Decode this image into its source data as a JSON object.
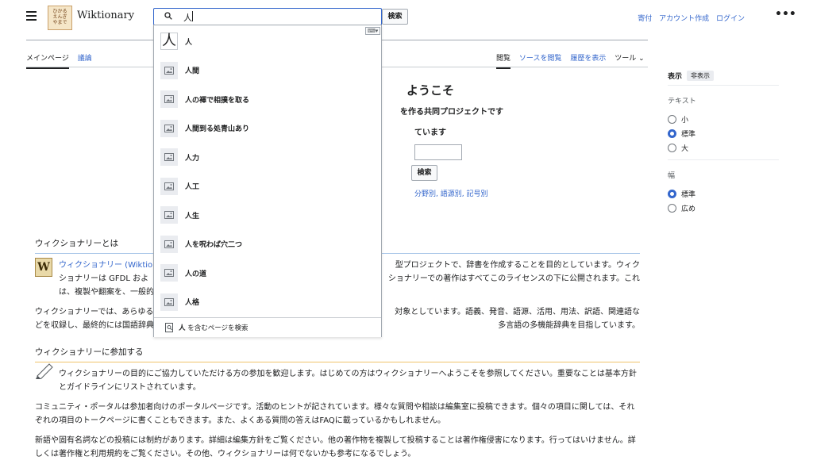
{
  "header": {
    "wordmark": "Wiktionary",
    "logo_text": "ひかる\nえんぎ\nやまで",
    "search_value": "人",
    "search_button": "検索",
    "user_links": [
      "寄付",
      "アカウント作成",
      "ログイン"
    ],
    "more": "•••"
  },
  "tabs": {
    "left": [
      "メインページ",
      "議論"
    ],
    "right": [
      "閲覧",
      "ソースを閲覧",
      "履歴を表示",
      "ツール ⌄"
    ]
  },
  "sidebar": {
    "title": "表示",
    "hide": "非表示",
    "text_label": "テキスト",
    "text_options": [
      {
        "label": "小",
        "selected": false
      },
      {
        "label": "標準",
        "selected": true
      },
      {
        "label": "大",
        "selected": false
      }
    ],
    "width_label": "幅",
    "width_options": [
      {
        "label": "標準",
        "selected": true
      },
      {
        "label": "広め",
        "selected": false
      }
    ]
  },
  "main": {
    "welcome_partial": "ようこそ",
    "sub1_partial": "を作る共同プロジェクトです",
    "sub2_partial": "ています",
    "inner_search_button": "検索",
    "category_links": "分野別, 語源別, 記号別",
    "about_title": "ウィクショナリーとは",
    "about_line1_left": "ウィクショナリー (Wiktio",
    "about_line1_right": "型プロジェクトで、辞書を作成することを目的としています。ウィク",
    "about_line2_left": "ショナリーは GFDL およ",
    "about_line2_right": "ショナリーでの著作はすべてこのライセンスの下に公開されます。これ",
    "about_line3_left": "は、複製や翻案を、一般的な著作",
    "about_p2_line1_left": "ウィクショナリーでは、あらゆる",
    "about_p2_line1_right": "対象としています。語義、発音、語源、活用、用法、訳語、関連語な",
    "about_p2_line2_left": "どを収録し、最終的には国語辞典",
    "about_p2_line2_right": "多言語の多機能辞典を目指しています。",
    "join_title": "ウィクショナリーに参加する",
    "join_p1": "ウィクショナリーの目的にご協力していただける方の参加を歓迎します。はじめての方はウィクショナリーへようこそを参照してください。重要なことは基本方針とガイドラインにリストされています。",
    "join_p2": "コミュニティ・ポータルは参加者向けのポータルページです。活動のヒントが記されています。様々な質問や相談は編集室に投稿できます。個々の項目に関しては、それぞれの項目のトークページに書くこともできます。また、よくある質問の答えはFAQに載っているかもしれません。",
    "join_p3": "新語や固有名詞などの投稿には制約があります。詳細は編集方針をご覧ください。他の著作物を複製して投稿することは著作権侵害になります。行ってはいけません。詳しくは著作権と利用規約をご覧ください。その他、ウィクショナリーは何でないかも参考になるでしょう。"
  },
  "suggestions": [
    "人",
    "人間",
    "人の褌で相撲を取る",
    "人間到る処青山あり",
    "人力",
    "人工",
    "人生",
    "人を呪わば穴二つ",
    "人の道",
    "人格"
  ],
  "suggestion_glyph": "人",
  "footer": {
    "query": "人",
    "suffix": " を含むページを検索"
  },
  "keyboard_label": "⌨▾"
}
